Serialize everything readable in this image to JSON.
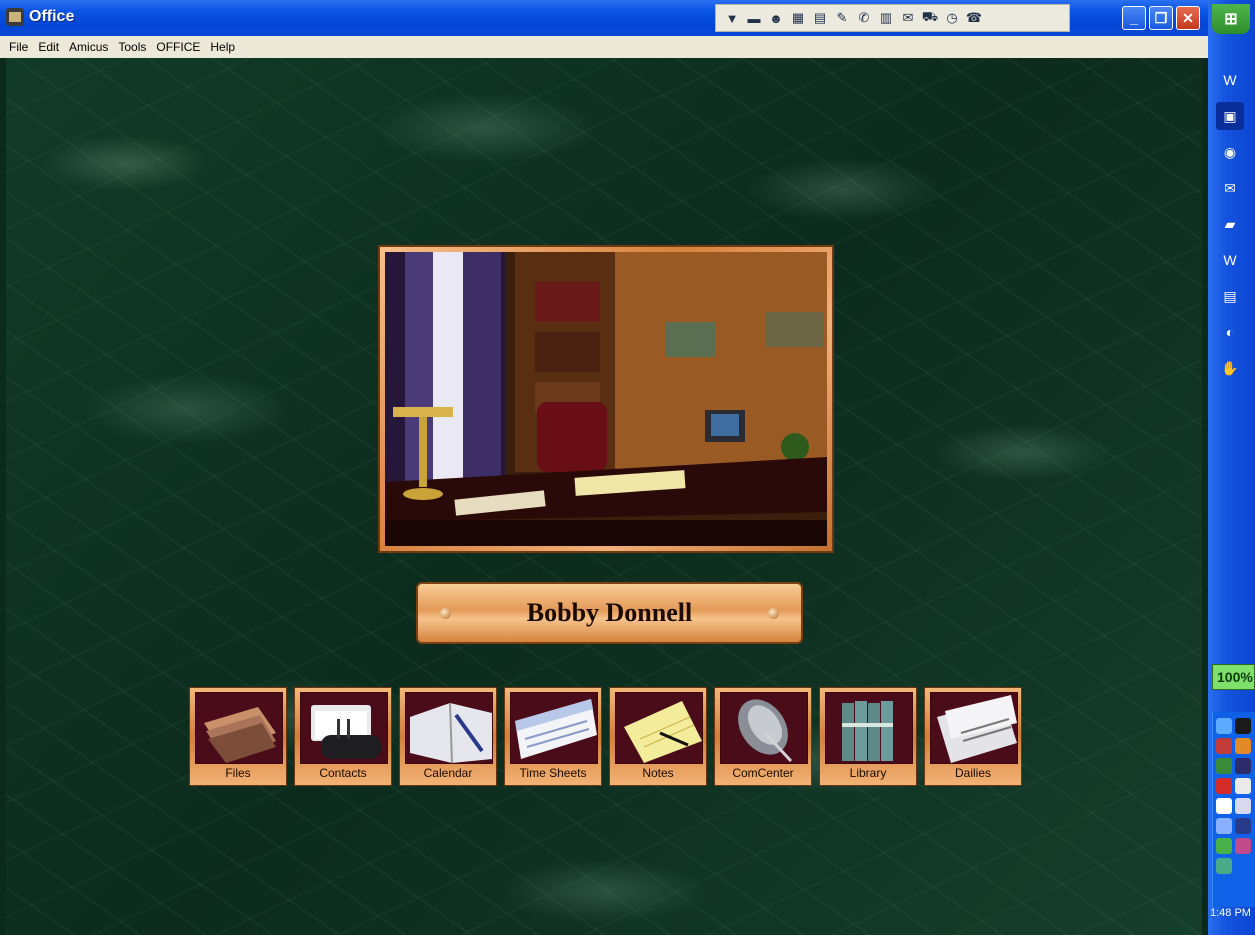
{
  "window": {
    "title": "Office"
  },
  "menubar": {
    "items": [
      "File",
      "Edit",
      "Amicus",
      "Tools",
      "OFFICE",
      "Help"
    ]
  },
  "toolbar": {
    "icons": [
      "dropdown-arrow-icon",
      "folder-icon",
      "contact-icon",
      "calendar-icon",
      "notes-icon",
      "edit-icon",
      "phone-icon",
      "library-icon",
      "money-icon",
      "car-icon",
      "timer-icon",
      "telephone-icon"
    ]
  },
  "nameplate": {
    "name": "Bobby Donnell"
  },
  "tiles": [
    {
      "label": "Files"
    },
    {
      "label": "Contacts"
    },
    {
      "label": "Calendar"
    },
    {
      "label": "Time Sheets"
    },
    {
      "label": "Notes"
    },
    {
      "label": "ComCenter"
    },
    {
      "label": "Library"
    },
    {
      "label": "Dailies"
    }
  ],
  "taskbar": {
    "battery": "100%",
    "clock": "1:48 PM"
  },
  "colors": {
    "titlebar": "#0a55e4",
    "marble": "#0c2b1d",
    "brass": "#e49a58"
  }
}
